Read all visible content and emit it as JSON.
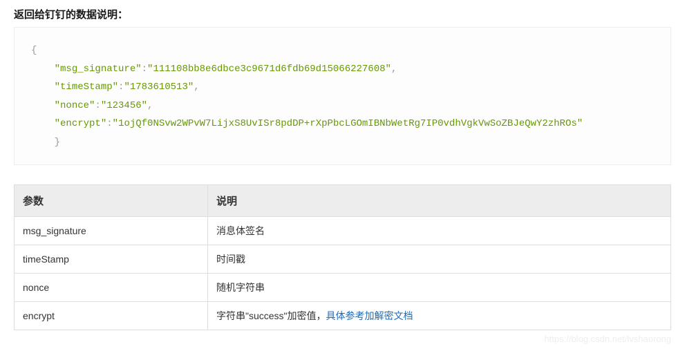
{
  "title": "返回给钉钉的数据说明：",
  "code": {
    "brace_open": "{",
    "brace_close": "}",
    "lines": [
      {
        "key": "\"msg_signature\"",
        "colon": ":",
        "value": "\"111108bb8e6dbce3c9671d6fdb69d15066227608\"",
        "comma": ","
      },
      {
        "key": "\"timeStamp\"",
        "colon": ":",
        "value": "\"1783610513\"",
        "comma": ","
      },
      {
        "key": "\"nonce\"",
        "colon": ":",
        "value": "\"123456\"",
        "comma": ","
      },
      {
        "key": "\"encrypt\"",
        "colon": ":",
        "value": "\"1ojQf0NSvw2WPvW7LijxS8UvISr8pdDP+rXpPbcLGOmIBNbWetRg7IP0vdhVgkVwSoZBJeQwY2zhROs\"",
        "comma": ""
      }
    ]
  },
  "table": {
    "headers": {
      "param": "参数",
      "desc": "说明"
    },
    "rows": [
      {
        "param": "msg_signature",
        "desc": "消息体签名"
      },
      {
        "param": "timeStamp",
        "desc": "时间戳"
      },
      {
        "param": "nonce",
        "desc": "随机字符串"
      },
      {
        "param": "encrypt",
        "desc_prefix": "字符串\"success\"加密值，",
        "desc_link": "具体参考加解密文档"
      }
    ]
  },
  "watermark": "https://blog.csdn.net/lvshaorong"
}
